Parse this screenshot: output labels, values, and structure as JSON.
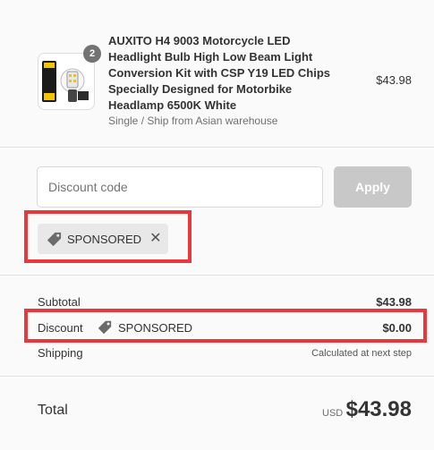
{
  "product": {
    "quantity": "2",
    "title": "AUXITO H4 9003 Motorcycle LED Headlight Bulb High Low Beam Light Conversion Kit with CSP Y19 LED Chips Specially Designed for Motorbike Headlamp 6500K White",
    "variant": "Single / Ship from Asian warehouse",
    "price": "$43.98"
  },
  "discount": {
    "placeholder": "Discount code",
    "apply_label": "Apply",
    "applied_code": "SPONSORED",
    "remove_glyph": "✕"
  },
  "summary": {
    "subtotal_label": "Subtotal",
    "subtotal_value": "$43.98",
    "discount_label": "Discount",
    "discount_code": "SPONSORED",
    "discount_value": "$0.00",
    "shipping_label": "Shipping",
    "shipping_value": "Calculated at next step",
    "total_label": "Total",
    "currency": "USD",
    "total_value": "$43.98"
  },
  "colors": {
    "highlight": "#e8383d",
    "apply_disabled": "#c8c8c8",
    "chip_bg": "#e8e8e8"
  }
}
